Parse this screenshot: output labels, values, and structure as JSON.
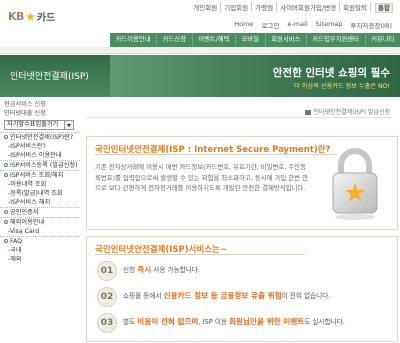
{
  "header": {
    "logo_kb": "KB",
    "logo_card": "카드",
    "util_top": [
      "개인회원",
      "기업회원",
      "가맹점",
      "사이버회원가입/변경",
      "회원탈퇴",
      "우리단"
    ],
    "util_tag": "통합",
    "util_mid": [
      "Home",
      "로그인",
      "e-mail",
      "Sitemap",
      "투자자광장(IR)"
    ]
  },
  "nav": {
    "items": [
      "카드이용안내",
      "카드신청",
      "이벤트/혜택",
      "모바일",
      "included_hidden",
      "회원서비스",
      "카드업무지원센터",
      "커뮤니티"
    ]
  },
  "banner": {
    "left_title": "인터넷안전결제(ISP)",
    "slogan": "안전한 인터넷 쇼핑의 필수",
    "sub": "더 이상의 신용카드 정보 누출은 NO!"
  },
  "sidebar": {
    "top_lines": [
      "현금서비스 신청",
      "인터넷대출 신청"
    ],
    "select_value": "자기앞수표입출가기",
    "sections": [
      {
        "head": "인터넷안전결제(ISP)란?",
        "items": [
          "-ISP서비스란?",
          "-ISP서비스 이용안내"
        ]
      },
      {
        "head": "ISP서비스등록 (발급신청)",
        "items": []
      },
      {
        "head": "ISP서비스 조회/해지",
        "items": [
          "-이용내역 조회",
          "-등록(발급)내역 조회",
          "-ISP서비스 해지"
        ]
      },
      {
        "head": "공인인증서",
        "items": []
      },
      {
        "head": "해외이용안내",
        "items": [
          "-Visa Card"
        ]
      },
      {
        "head": "FAQ",
        "items": [
          "-국내",
          "-해외"
        ]
      }
    ]
  },
  "main": {
    "breadcrumb": "인터넷안전결제(ISP) 발급신청",
    "box1": {
      "title": "국민인터넷안전결제(ISP : Internet Secure Payment)란?",
      "text": "기존 전자상거래에 이용시 매번 카드정보(카드번호, 유효기간, 비밀번호, 주민등록번호)를 입력함으로써 발생할 수 있는 위험을 최소화하고, 동시에 가입 한번 만으로 보다 간편하게 전자정거래를 이용하시도록 개발된 안전한 결제방식입니다."
    },
    "box2": {
      "title": "국민인터넷안전결제(ISP)서비스는~",
      "steps": [
        {
          "num": "01",
          "pre": "신청 ",
          "hl": "즉시",
          "post": " 사용 가능합니다."
        },
        {
          "num": "02",
          "pre": "쇼핑몰 등에서 ",
          "hl": "신용카드 정보 등 금융정보 유출 위험",
          "post": "이 전혀 없습니다."
        },
        {
          "num": "03",
          "pre": "별도 ",
          "hl": "비용이 전혀 없으며",
          "mid": ", ISP 이용 ",
          "hl2": "회원님만을 위한 이벤트",
          "post": "도 실시합니다."
        }
      ]
    }
  },
  "colors": {
    "brand_green": "#4a8d63",
    "accent_orange": "#e8791c"
  }
}
